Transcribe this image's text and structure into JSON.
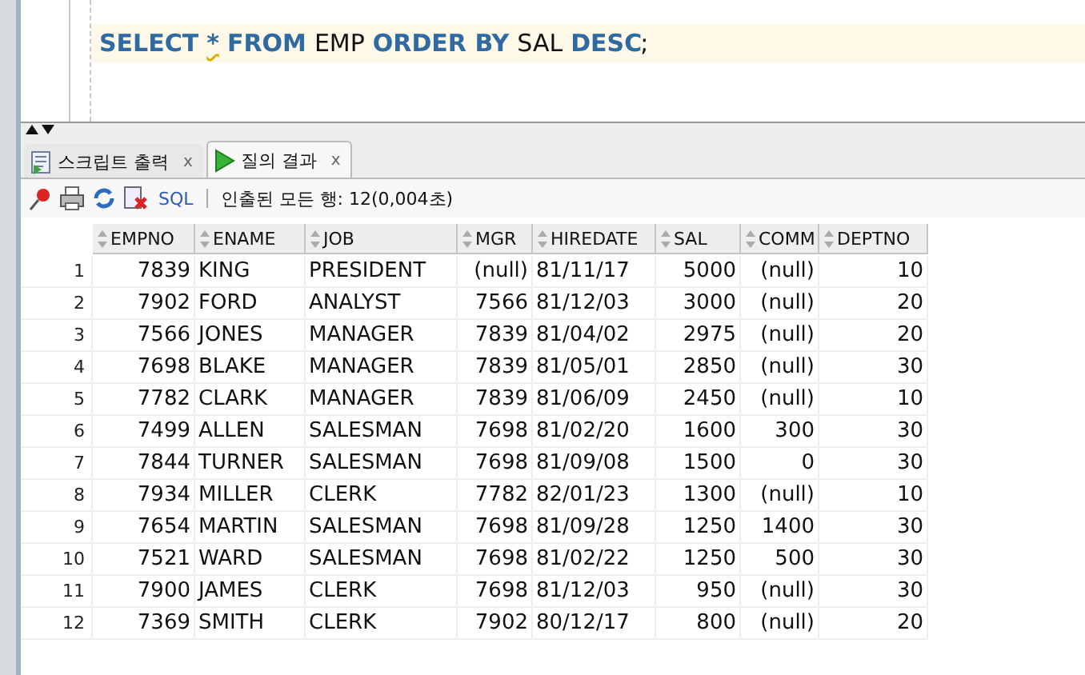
{
  "editor": {
    "tokens": [
      {
        "text": "SELECT",
        "kind": "keyword"
      },
      {
        "text": "*",
        "kind": "warning"
      },
      {
        "text": "FROM",
        "kind": "keyword"
      },
      {
        "text": "EMP",
        "kind": "ident"
      },
      {
        "text": "ORDER BY",
        "kind": "keyword"
      },
      {
        "text": "SAL",
        "kind": "ident"
      },
      {
        "text": "DESC",
        "kind": "keyword"
      },
      {
        "text": ";",
        "kind": "punct"
      }
    ]
  },
  "tabs": [
    {
      "label": "스크립트 출력",
      "kind": "script",
      "selected": false,
      "close": "x"
    },
    {
      "label": "질의 결과",
      "kind": "run",
      "selected": true,
      "close": "x"
    }
  ],
  "toolbar": {
    "sql_link": "SQL",
    "status": "인출된 모든 행: 12(0,004초)"
  },
  "table": {
    "columns": [
      {
        "label": "EMPNO"
      },
      {
        "label": "ENAME"
      },
      {
        "label": "JOB"
      },
      {
        "label": "MGR"
      },
      {
        "label": "HIREDATE"
      },
      {
        "label": "SAL"
      },
      {
        "label": "COMM"
      },
      {
        "label": "DEPTNO"
      }
    ],
    "rows": [
      {
        "num": "1",
        "cells": [
          "7839",
          "KING",
          "PRESIDENT",
          "(null)",
          "81/11/17",
          "5000",
          "(null)",
          "10"
        ]
      },
      {
        "num": "2",
        "cells": [
          "7902",
          "FORD",
          "ANALYST",
          "7566",
          "81/12/03",
          "3000",
          "(null)",
          "20"
        ]
      },
      {
        "num": "3",
        "cells": [
          "7566",
          "JONES",
          "MANAGER",
          "7839",
          "81/04/02",
          "2975",
          "(null)",
          "20"
        ]
      },
      {
        "num": "4",
        "cells": [
          "7698",
          "BLAKE",
          "MANAGER",
          "7839",
          "81/05/01",
          "2850",
          "(null)",
          "30"
        ]
      },
      {
        "num": "5",
        "cells": [
          "7782",
          "CLARK",
          "MANAGER",
          "7839",
          "81/06/09",
          "2450",
          "(null)",
          "10"
        ]
      },
      {
        "num": "6",
        "cells": [
          "7499",
          "ALLEN",
          "SALESMAN",
          "7698",
          "81/02/20",
          "1600",
          "300",
          "30"
        ]
      },
      {
        "num": "7",
        "cells": [
          "7844",
          "TURNER",
          "SALESMAN",
          "7698",
          "81/09/08",
          "1500",
          "0",
          "30"
        ]
      },
      {
        "num": "8",
        "cells": [
          "7934",
          "MILLER",
          "CLERK",
          "7782",
          "82/01/23",
          "1300",
          "(null)",
          "10"
        ]
      },
      {
        "num": "9",
        "cells": [
          "7654",
          "MARTIN",
          "SALESMAN",
          "7698",
          "81/09/28",
          "1250",
          "1400",
          "30"
        ]
      },
      {
        "num": "10",
        "cells": [
          "7521",
          "WARD",
          "SALESMAN",
          "7698",
          "81/02/22",
          "1250",
          "500",
          "30"
        ]
      },
      {
        "num": "11",
        "cells": [
          "7900",
          "JAMES",
          "CLERK",
          "7698",
          "81/12/03",
          "950",
          "(null)",
          "30"
        ]
      },
      {
        "num": "12",
        "cells": [
          "7369",
          "SMITH",
          "CLERK",
          "7902",
          "80/12/17",
          "800",
          "(null)",
          "20"
        ]
      }
    ]
  }
}
